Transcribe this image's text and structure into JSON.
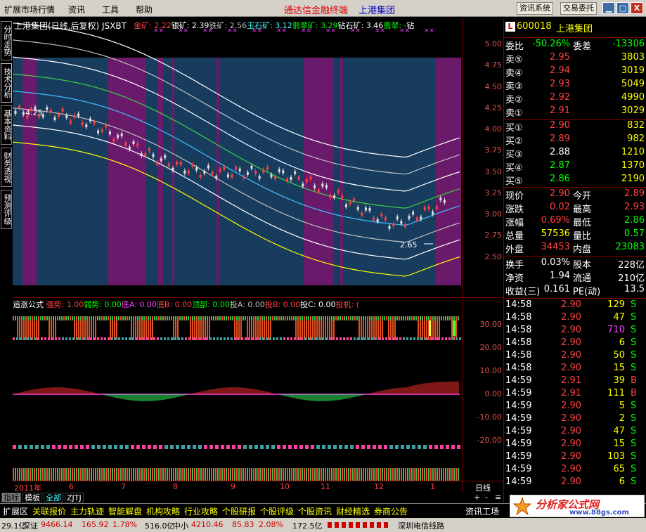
{
  "menu": {
    "items": [
      "扩展市场行情",
      "资讯",
      "工具",
      "帮助"
    ],
    "app_title": "通达信金融终端",
    "stock_title": "上港集团",
    "btn_info": "资讯系统",
    "btn_trade": "交易委托",
    "win_min": "▁",
    "win_max": "□",
    "win_close": "X"
  },
  "side_tabs": [
    "分时走势",
    "技术分析",
    "基本资料",
    "财务透视",
    "预测评级"
  ],
  "chart": {
    "title": "上港集团(日线,后复权) JSXBT",
    "indicators": [
      {
        "label": "金矿: 2.22",
        "color": "#ff4040"
      },
      {
        "label": "银矿: 2.39",
        "color": "#ffffff"
      },
      {
        "label": "铁矿: 2.56",
        "color": "#c0c0c0"
      },
      {
        "label": "玉石矿: 3.12",
        "color": "#40ffff"
      },
      {
        "label": "翡翠矿: 3.29",
        "color": "#00ff00"
      },
      {
        "label": "钻石矿: 3.46",
        "color": "#ffffff"
      },
      {
        "label": "翡翠: -",
        "color": "#00ff00"
      },
      {
        "label": "钻",
        "color": "#ffffff"
      }
    ],
    "high_label": "4.25",
    "low_label": "2.65",
    "y_ticks": [
      "5.00",
      "4.75",
      "4.50",
      "4.25",
      "4.00",
      "3.75",
      "3.50",
      "3.25",
      "3.00",
      "2.75",
      "2.50"
    ]
  },
  "sub": {
    "title": "追涨公式",
    "items": [
      {
        "label": "强势: 1.00",
        "color": "#ff4040"
      },
      {
        "label": "弱势: 0.00",
        "color": "#00ff00"
      },
      {
        "label": "底A: 0.00",
        "color": "#ff40ff"
      },
      {
        "label": "底B: 0.00",
        "color": "#ff4040"
      },
      {
        "label": "顶部: 0.00",
        "color": "#00ff00"
      },
      {
        "label": "投A: 0.00",
        "color": "#c0c0c0"
      },
      {
        "label": "投B: 0.00",
        "color": "#ff4040"
      },
      {
        "label": "投C: 0.00",
        "color": "#ffffff"
      },
      {
        "label": "投机: (",
        "color": "#ff4040"
      }
    ],
    "y_ticks": [
      "30.00",
      "20.00",
      "10.00",
      "0.00",
      "-10.00",
      "-20.00"
    ]
  },
  "x_axis": {
    "labels": [
      "2011年",
      "6",
      "7",
      "8",
      "9",
      "10",
      "11",
      "12",
      "1"
    ],
    "period": "日线"
  },
  "quote": {
    "code": "600018",
    "name": "上港集团",
    "wb_label": "委比",
    "wb": "-50.26%",
    "wc_label": "委差",
    "wc": "-13306",
    "sells": [
      {
        "l": "卖⑤",
        "p": "2.95",
        "v": "3803"
      },
      {
        "l": "卖④",
        "p": "2.94",
        "v": "3019"
      },
      {
        "l": "卖③",
        "p": "2.93",
        "v": "5049"
      },
      {
        "l": "卖②",
        "p": "2.92",
        "v": "4990"
      },
      {
        "l": "卖①",
        "p": "2.91",
        "v": "3029"
      }
    ],
    "buys": [
      {
        "l": "买①",
        "p": "2.90",
        "v": "832"
      },
      {
        "l": "买②",
        "p": "2.89",
        "v": "982"
      },
      {
        "l": "买③",
        "p": "2.88",
        "v": "1210"
      },
      {
        "l": "买④",
        "p": "2.87",
        "v": "1370"
      },
      {
        "l": "买⑤",
        "p": "2.86",
        "v": "2190"
      }
    ],
    "stats": [
      {
        "a": "现价",
        "b": "2.90",
        "c": "今开",
        "d": "2.89"
      },
      {
        "a": "涨跌",
        "b": "0.02",
        "c": "最高",
        "d": "2.93"
      },
      {
        "a": "涨幅",
        "b": "0.69%",
        "c": "最低",
        "d": "2.86"
      },
      {
        "a": "总量",
        "b": "57536",
        "c": "量比",
        "d": "0.57"
      },
      {
        "a": "外盘",
        "b": "34453",
        "c": "内盘",
        "d": "23083"
      }
    ],
    "stats2": [
      {
        "a": "换手",
        "b": "0.03%",
        "c": "股本",
        "d": "228亿"
      },
      {
        "a": "净资",
        "b": "1.94",
        "c": "流通",
        "d": "210亿"
      },
      {
        "a": "收益(三)",
        "b": "0.161",
        "c": "PE(动)",
        "d": "13.5"
      }
    ],
    "ticks": [
      {
        "t": "14:58",
        "p": "2.90",
        "v": "129",
        "s": "S"
      },
      {
        "t": "14:58",
        "p": "2.90",
        "v": "47",
        "s": "S"
      },
      {
        "t": "14:58",
        "p": "2.90",
        "v": "710",
        "s": "S"
      },
      {
        "t": "14:58",
        "p": "2.90",
        "v": "6",
        "s": "S"
      },
      {
        "t": "14:58",
        "p": "2.90",
        "v": "50",
        "s": "S"
      },
      {
        "t": "14:58",
        "p": "2.90",
        "v": "15",
        "s": "S"
      },
      {
        "t": "14:59",
        "p": "2.91",
        "v": "39",
        "s": "B"
      },
      {
        "t": "14:59",
        "p": "2.91",
        "v": "111",
        "s": "B"
      },
      {
        "t": "14:59",
        "p": "2.90",
        "v": "5",
        "s": "S"
      },
      {
        "t": "14:59",
        "p": "2.90",
        "v": "2",
        "s": "S"
      },
      {
        "t": "14:59",
        "p": "2.90",
        "v": "47",
        "s": "S"
      },
      {
        "t": "14:59",
        "p": "2.90",
        "v": "15",
        "s": "S"
      },
      {
        "t": "14:59",
        "p": "2.90",
        "v": "103",
        "s": "S"
      },
      {
        "t": "14:59",
        "p": "2.90",
        "v": "65",
        "s": "S"
      },
      {
        "t": "14:59",
        "p": "2.90",
        "v": "6",
        "s": "S"
      }
    ]
  },
  "bottom_tabs": [
    "指标",
    "模板",
    "全部",
    "ZJTJ"
  ],
  "func_items": [
    "扩展区",
    "关联报价",
    "主力轨迹",
    "智能解盘",
    "机构攻略",
    "行业攻略",
    "个股研报",
    "个股评级",
    "个股资讯",
    "财经精选",
    "券商公告"
  ],
  "func_right": "资讯工场",
  "status": {
    "s1": "29.1亿",
    "s2": "深证",
    "s3": "9466.14",
    "s4": "165.92",
    "s5": "1.78%",
    "s6": "516.0亿",
    "s7": "中小",
    "s8": "4210.46",
    "s9": "85.83",
    "s10": "2.08%",
    "s11": "172.5亿",
    "s12": "深圳电信线路"
  },
  "logo": {
    "text": "分析家公式网",
    "url": "www.88gs.com"
  }
}
